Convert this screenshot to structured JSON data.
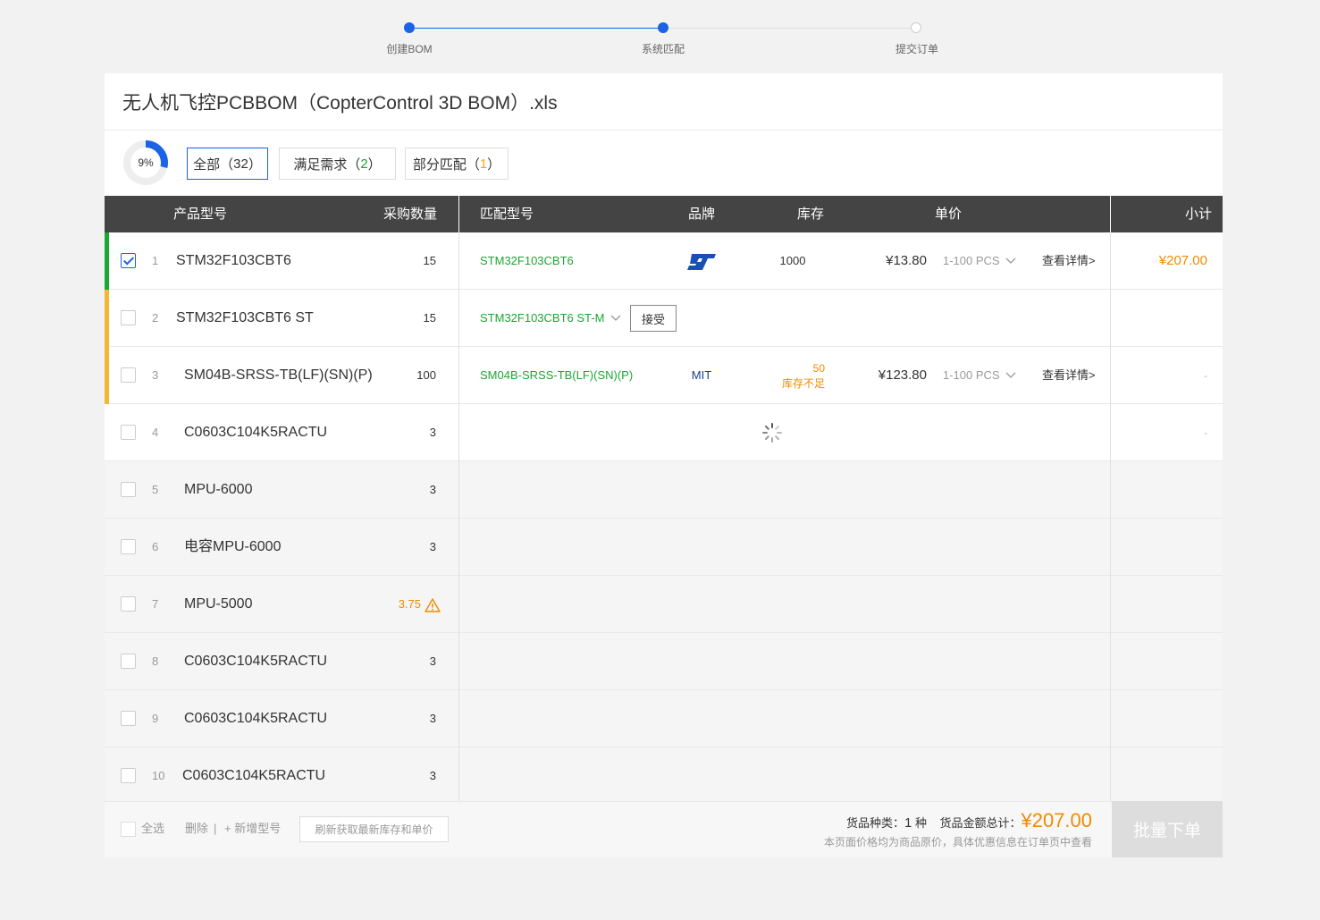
{
  "stepper": {
    "steps": [
      {
        "label": "创建BOM",
        "state": "done"
      },
      {
        "label": "系统匹配",
        "state": "current"
      },
      {
        "label": "提交订单",
        "state": "todo"
      }
    ]
  },
  "file_title": "无人机飞控PCBBOM（CopterControl 3D BOM）.xls",
  "progress": {
    "percent_label": "9%",
    "fraction": 0.09
  },
  "filters": {
    "all": {
      "label": "全部（",
      "count": "32",
      "suffix": "）"
    },
    "satisfied": {
      "label": "满足需求（",
      "count": "2",
      "suffix": "）"
    },
    "partial": {
      "label": "部分匹配（",
      "count": "1",
      "suffix": "）"
    }
  },
  "table": {
    "headers": {
      "product_model": "产品型号",
      "quantity": "采购数量",
      "match_model": "匹配型号",
      "brand": "品牌",
      "stock": "库存",
      "unit_price": "单价",
      "subtotal": "小计"
    },
    "rows": [
      {
        "index": "1",
        "name": "STM32F103CBT6",
        "qty": "15",
        "match": "STM32F103CBT6",
        "brand": "ST",
        "stock": "1000",
        "price": "¥13.80",
        "range": "1-100 PCS",
        "detail": "查看详情>",
        "subtotal": "¥207.00",
        "status": "ok",
        "checked": true
      },
      {
        "index": "2",
        "name": "STM32F103CBT6 ST",
        "qty": "15",
        "match": "STM32F103CBT6 ST-M",
        "accept": "接受",
        "status": "partial",
        "checked": false
      },
      {
        "index": "3",
        "name": "SM04B-SRSS-TB(LF)(SN)(P)",
        "qty": "100",
        "match": "SM04B-SRSS-TB(LF)(SN)(P)",
        "brand": "MIT",
        "stock": "50",
        "stock_note": "库存不足",
        "price": "¥123.80",
        "range": "1-100 PCS",
        "detail": "查看详情>",
        "subtotal": "-",
        "status": "partial",
        "checked": false
      },
      {
        "index": "4",
        "name": "C0603C104K5RACTU",
        "qty": "3",
        "subtotal": "-",
        "status": "loading",
        "checked": false
      },
      {
        "index": "5",
        "name": "MPU-6000",
        "qty": "3",
        "status": "pending",
        "checked": false
      },
      {
        "index": "6",
        "name": "电容MPU-6000",
        "qty": "3",
        "status": "pending",
        "checked": false
      },
      {
        "index": "7",
        "name": "MPU-5000",
        "qty": "3.75",
        "qty_warning": true,
        "status": "pending",
        "checked": false
      },
      {
        "index": "8",
        "name": "C0603C104K5RACTU",
        "qty": "3",
        "status": "pending",
        "checked": false
      },
      {
        "index": "9",
        "name": "C0603C104K5RACTU",
        "qty": "3",
        "status": "pending",
        "checked": false
      },
      {
        "index": "10",
        "name": "C0603C104K5RACTU",
        "qty": "3",
        "status": "pending",
        "checked": false
      }
    ]
  },
  "footer": {
    "select_all": "全选",
    "delete": "删除",
    "divider": "|",
    "add_model": "+ 新增型号",
    "refresh": "刷新获取最新库存和单价",
    "kinds_label": "货品种类：",
    "kinds_count": "1",
    "kinds_unit": "种",
    "total_label": "货品金额总计：",
    "total_value": "¥207.00",
    "note": "本页面价格均为商品原价，具体优惠信息在订单页中查看",
    "order_button": "批量下单"
  },
  "colors": {
    "accent": "#1a62e6",
    "ok_bar": "#19a832",
    "partial_bar": "#f5b731",
    "price_orange": "#f08a00",
    "header_bg": "#444444"
  }
}
